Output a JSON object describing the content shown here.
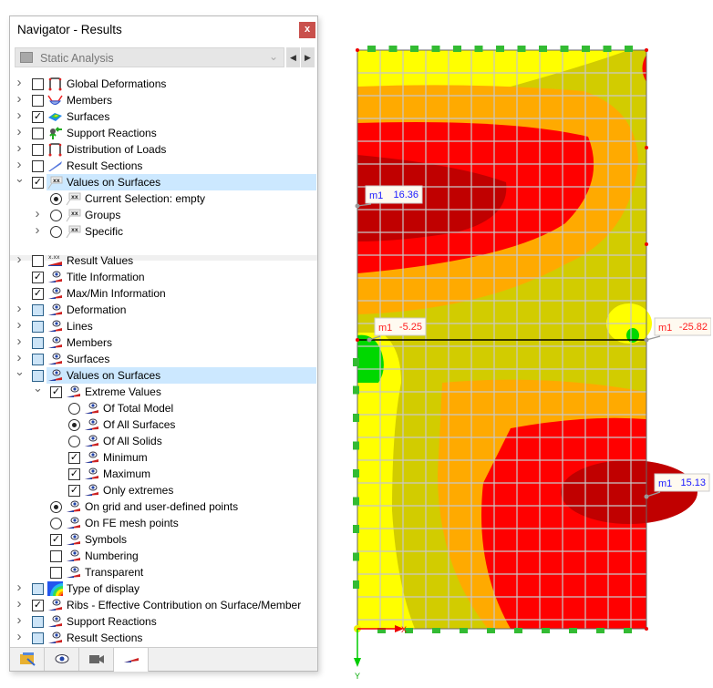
{
  "navigator": {
    "title": "Navigator - Results",
    "close_label": "x",
    "load_case": "Static Analysis",
    "tree_top": [
      {
        "label": "Global Deformations",
        "level": 0,
        "exp": ">",
        "ctl": "cb-off",
        "icon": "deformation-icon"
      },
      {
        "label": "Members",
        "level": 0,
        "exp": ">",
        "ctl": "cb-off",
        "icon": "members-icon"
      },
      {
        "label": "Surfaces",
        "level": 0,
        "exp": ">",
        "ctl": "cb-on",
        "icon": "surfaces-icon"
      },
      {
        "label": "Support Reactions",
        "level": 0,
        "exp": ">",
        "ctl": "cb-off",
        "icon": "support-reactions-icon"
      },
      {
        "label": "Distribution of Loads",
        "level": 0,
        "exp": ">",
        "ctl": "cb-off",
        "icon": "deformation-icon"
      },
      {
        "label": "Result Sections",
        "level": 0,
        "exp": ">",
        "ctl": "cb-off",
        "icon": "result-sections-icon"
      },
      {
        "label": "Values on Surfaces",
        "level": 0,
        "exp": "v",
        "ctl": "cb-on",
        "icon": "values-icon",
        "selected": true
      },
      {
        "label": "Current Selection: empty",
        "level": 1,
        "exp": "",
        "ctl": "rb-on",
        "icon": "values-icon"
      },
      {
        "label": "Groups",
        "level": 1,
        "exp": ">",
        "ctl": "rb-off",
        "icon": "values-icon"
      },
      {
        "label": "Specific",
        "level": 1,
        "exp": ">",
        "ctl": "rb-off",
        "icon": "values-icon"
      }
    ],
    "tree_bottom": [
      {
        "label": "Result Values",
        "level": 0,
        "exp": ">",
        "ctl": "cb-off",
        "icon": "result-values-icon"
      },
      {
        "label": "Title Information",
        "level": 0,
        "exp": "",
        "ctl": "cb-on",
        "icon": "display-icon"
      },
      {
        "label": "Max/Min Information",
        "level": 0,
        "exp": "",
        "ctl": "cb-on",
        "icon": "display-icon"
      },
      {
        "label": "Deformation",
        "level": 0,
        "exp": ">",
        "ctl": "cb-partial",
        "icon": "display-icon"
      },
      {
        "label": "Lines",
        "level": 0,
        "exp": ">",
        "ctl": "cb-partial",
        "icon": "display-icon"
      },
      {
        "label": "Members",
        "level": 0,
        "exp": ">",
        "ctl": "cb-partial",
        "icon": "display-icon"
      },
      {
        "label": "Surfaces",
        "level": 0,
        "exp": ">",
        "ctl": "cb-partial",
        "icon": "display-icon"
      },
      {
        "label": "Values on Surfaces",
        "level": 0,
        "exp": "v",
        "ctl": "cb-partial",
        "icon": "display-icon",
        "selected": true
      },
      {
        "label": "Extreme Values",
        "level": 1,
        "exp": "v",
        "ctl": "cb-on",
        "icon": "display-icon"
      },
      {
        "label": "Of Total Model",
        "level": 2,
        "exp": "",
        "ctl": "rb-off",
        "icon": "display-icon"
      },
      {
        "label": "Of All Surfaces",
        "level": 2,
        "exp": "",
        "ctl": "rb-on",
        "icon": "display-icon"
      },
      {
        "label": "Of All Solids",
        "level": 2,
        "exp": "",
        "ctl": "rb-off",
        "icon": "display-icon"
      },
      {
        "label": "Minimum",
        "level": 2,
        "exp": "",
        "ctl": "cb-on",
        "icon": "display-icon"
      },
      {
        "label": "Maximum",
        "level": 2,
        "exp": "",
        "ctl": "cb-on",
        "icon": "display-icon"
      },
      {
        "label": "Only extremes",
        "level": 2,
        "exp": "",
        "ctl": "cb-on",
        "icon": "display-icon"
      },
      {
        "label": "On grid and user-defined points",
        "level": 1,
        "exp": "",
        "ctl": "rb-on",
        "icon": "display-icon"
      },
      {
        "label": "On FE mesh points",
        "level": 1,
        "exp": "",
        "ctl": "rb-off",
        "icon": "display-icon"
      },
      {
        "label": "Symbols",
        "level": 1,
        "exp": "",
        "ctl": "cb-on",
        "icon": "display-icon"
      },
      {
        "label": "Numbering",
        "level": 1,
        "exp": "",
        "ctl": "cb-off",
        "icon": "display-icon"
      },
      {
        "label": "Transparent",
        "level": 1,
        "exp": "",
        "ctl": "cb-off",
        "icon": "display-icon"
      },
      {
        "label": "Type of display",
        "level": 0,
        "exp": ">",
        "ctl": "cb-partial",
        "icon": "type-of-display-icon"
      },
      {
        "label": "Ribs - Effective Contribution on Surface/Member",
        "level": 0,
        "exp": ">",
        "ctl": "cb-on",
        "icon": "display-icon"
      },
      {
        "label": "Support Reactions",
        "level": 0,
        "exp": ">",
        "ctl": "cb-partial",
        "icon": "display-icon"
      },
      {
        "label": "Result Sections",
        "level": 0,
        "exp": ">",
        "ctl": "cb-partial",
        "icon": "display-icon"
      }
    ],
    "tabs": [
      {
        "icon": "data-folder-icon"
      },
      {
        "icon": "eye-icon"
      },
      {
        "icon": "camera-icon"
      },
      {
        "icon": "results-display-icon",
        "active": true
      }
    ]
  },
  "graphic": {
    "labels": [
      {
        "sym": "m1",
        "value": "16.36",
        "color": "#1a1aff"
      },
      {
        "sym": "m1",
        "value": "-5.25",
        "color": "#ff2020"
      },
      {
        "sym": "m1",
        "value": "-25.82",
        "color": "#ff2020"
      },
      {
        "sym": "m1",
        "value": "15.13",
        "color": "#1a1aff"
      }
    ],
    "axis_y": "Y",
    "axis_x": "X",
    "colors": {
      "yellow": "#ffff00",
      "olive": "#d2cc00",
      "orange": "#ffaa00",
      "red": "#ff0000",
      "darkred": "#c00000",
      "green": "#00d800"
    }
  }
}
